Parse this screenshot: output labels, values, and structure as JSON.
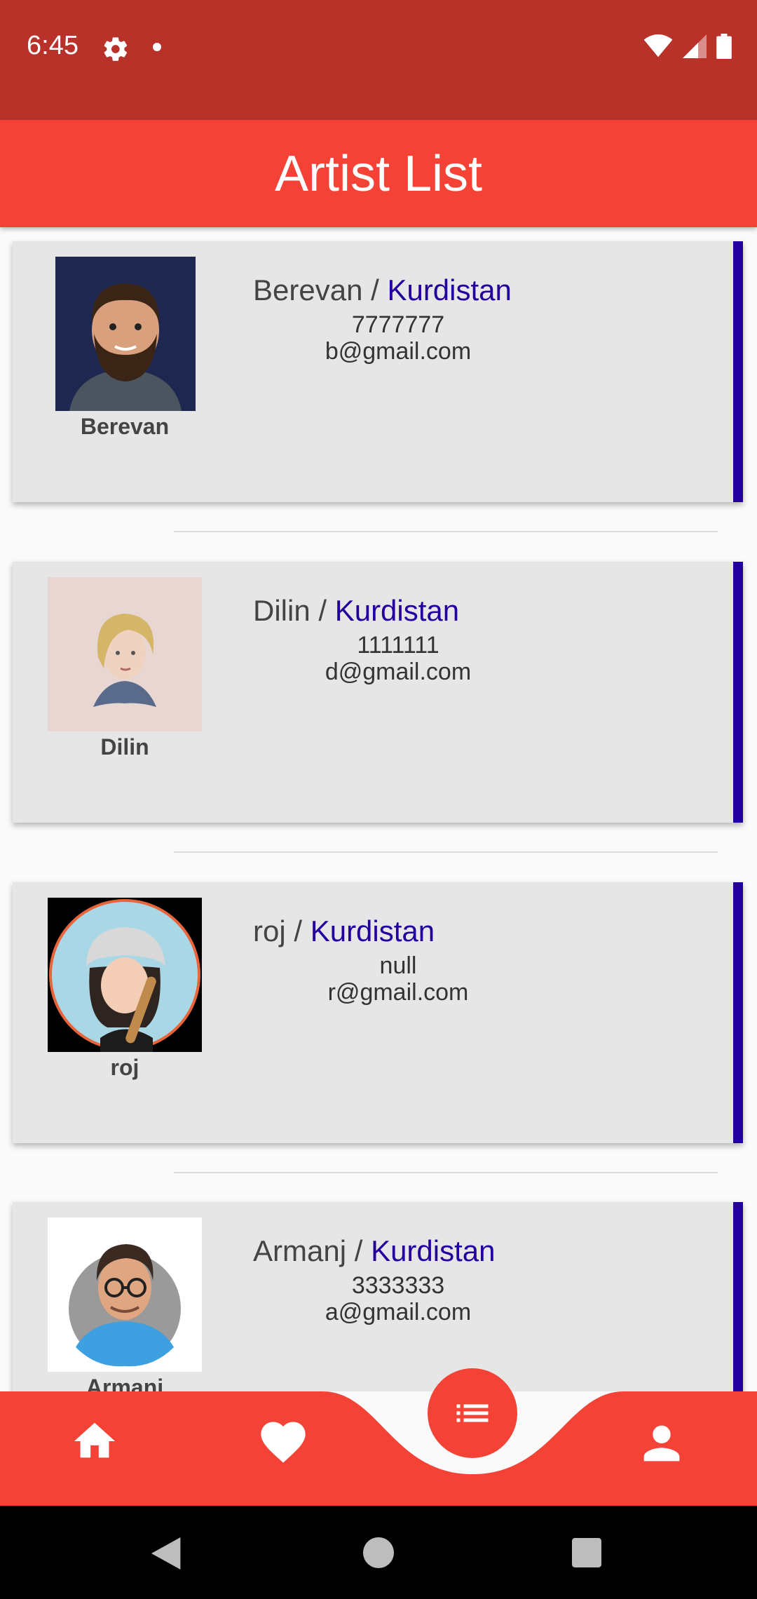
{
  "status_bar": {
    "time": "6:45"
  },
  "app_bar": {
    "title": "Artist List"
  },
  "artists": [
    {
      "name": "Berevan",
      "separator": " / ",
      "country": "Kurdistan",
      "phone": "7777777",
      "email": "b@gmail.com",
      "caption": "Berevan"
    },
    {
      "name": "Dilin",
      "separator": " / ",
      "country": "Kurdistan",
      "phone": "1111111",
      "email": "d@gmail.com",
      "caption": "Dilin"
    },
    {
      "name": "roj",
      "separator": " / ",
      "country": "Kurdistan",
      "phone": "null",
      "email": "r@gmail.com",
      "caption": "roj"
    },
    {
      "name": "Armanj",
      "separator": " / ",
      "country": "Kurdistan",
      "phone": "3333333",
      "email": "a@gmail.com",
      "caption": "Armanj"
    }
  ],
  "bottom_nav": {
    "items": [
      {
        "icon": "home-icon"
      },
      {
        "icon": "heart-icon"
      },
      {
        "icon": "list-icon",
        "selected": true
      },
      {
        "icon": "person-icon"
      }
    ]
  },
  "colors": {
    "status_bar": "#b8322a",
    "primary": "#f44336",
    "accent": "#23009e",
    "card": "#e6e6e6"
  }
}
